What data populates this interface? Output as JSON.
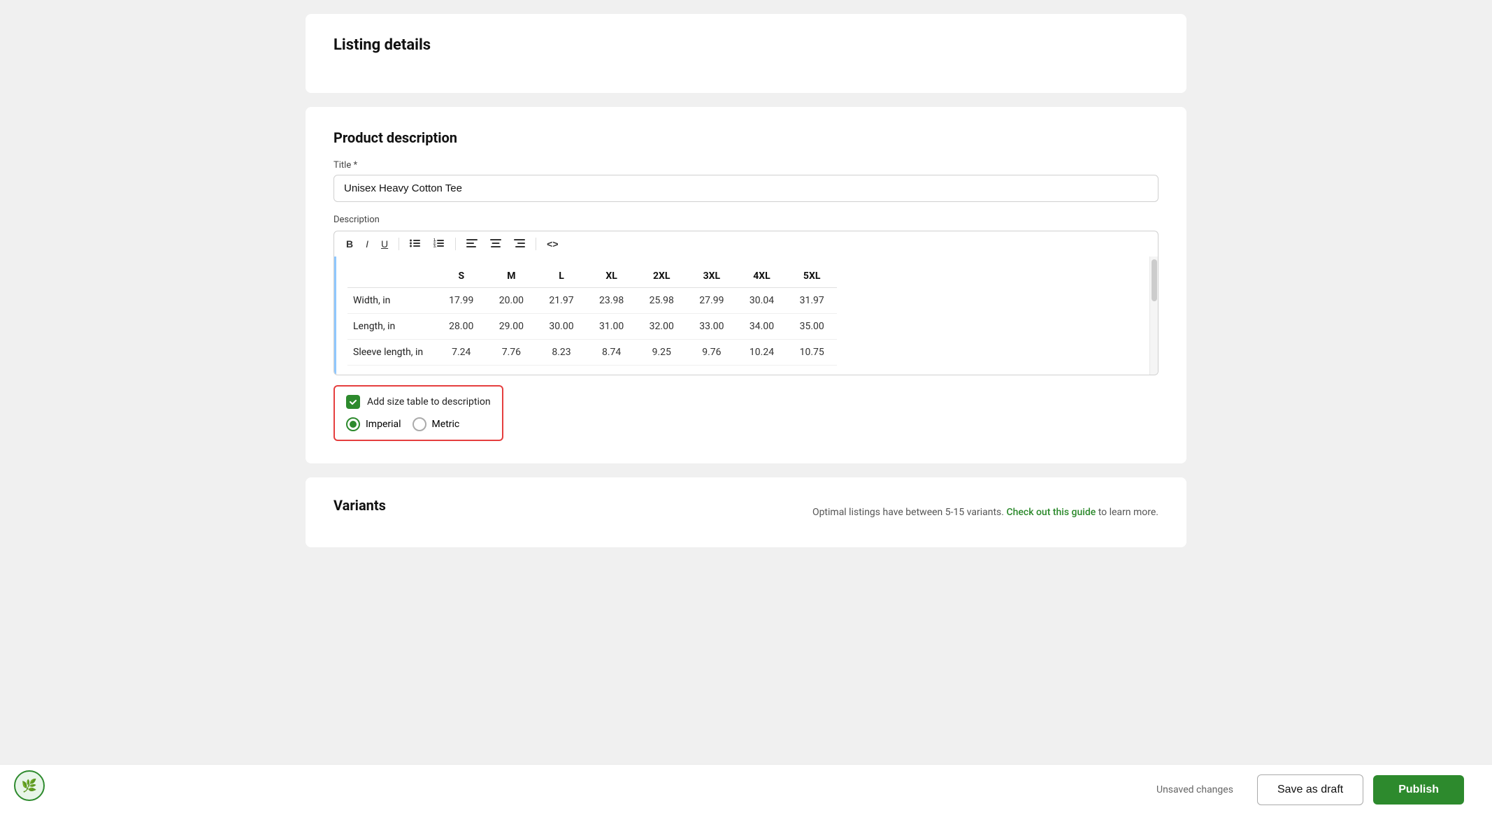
{
  "page": {
    "title": "Listing details"
  },
  "product_description": {
    "heading": "Product description",
    "title_label": "Title *",
    "title_value": "Unisex Heavy Cotton Tee",
    "description_label": "Description"
  },
  "toolbar": {
    "bold": "B",
    "italic": "I",
    "underline": "U",
    "unordered_list": "≡",
    "ordered_list": "≡",
    "align_left": "≡",
    "align_center": "≡",
    "align_right": "≡",
    "code": "<>"
  },
  "size_table": {
    "columns": [
      "",
      "S",
      "M",
      "L",
      "XL",
      "2XL",
      "3XL",
      "4XL",
      "5XL"
    ],
    "rows": [
      {
        "label": "Width, in",
        "values": [
          "17.99",
          "20.00",
          "21.97",
          "23.98",
          "25.98",
          "27.99",
          "30.04",
          "31.97"
        ]
      },
      {
        "label": "Length, in",
        "values": [
          "28.00",
          "29.00",
          "30.00",
          "31.00",
          "32.00",
          "33.00",
          "34.00",
          "35.00"
        ]
      },
      {
        "label": "Sleeve length, in",
        "values": [
          "7.24",
          "7.76",
          "8.23",
          "8.74",
          "9.25",
          "9.76",
          "10.24",
          "10.75"
        ]
      }
    ]
  },
  "size_table_options": {
    "checkbox_label": "Add size table to description",
    "imperial_label": "Imperial",
    "metric_label": "Metric",
    "imperial_selected": true
  },
  "variants": {
    "heading": "Variants",
    "hint_text": "Optimal listings have between 5-15 variants.",
    "guide_link": "Check out this guide",
    "hint_suffix": "to learn more."
  },
  "bottom_bar": {
    "unsaved_text": "Unsaved changes",
    "save_draft_label": "Save as draft",
    "publish_label": "Publish"
  },
  "avatar": {
    "emoji": "🌿"
  }
}
